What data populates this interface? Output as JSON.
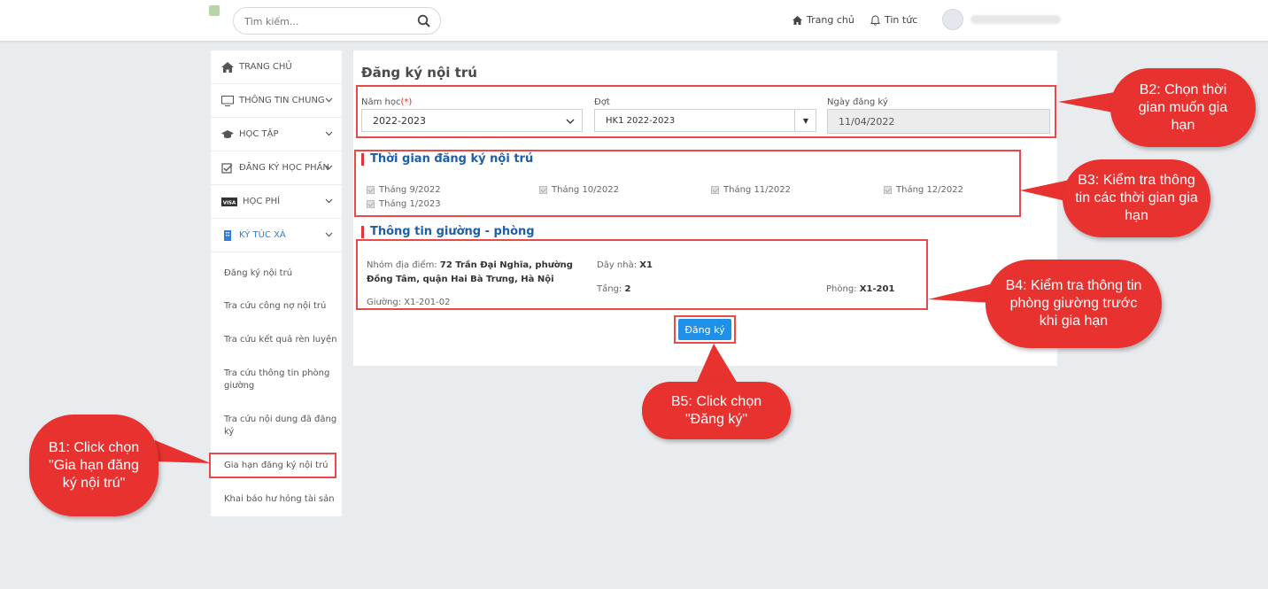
{
  "topbar": {
    "search_placeholder": "Tìm kiếm...",
    "home_label": "Trang chủ",
    "news_label": "Tin tức"
  },
  "sidebar": {
    "menu": [
      {
        "label": "TRANG CHỦ",
        "icon": "home-icon"
      },
      {
        "label": "THÔNG TIN CHUNG",
        "icon": "monitor-icon"
      },
      {
        "label": "HỌC TẬP",
        "icon": "graduation-cap-icon"
      },
      {
        "label": "ĐĂNG KÝ HỌC PHẦN",
        "icon": "checkbox-icon"
      },
      {
        "label": "HỌC PHÍ",
        "icon": "visa-card-icon"
      },
      {
        "label": "KÝ TÚC XÁ",
        "icon": "building-icon"
      }
    ],
    "sub_items": [
      "Đăng ký nội trú",
      "Tra cứu công nợ nội trú",
      "Tra cứu kết quả rèn luyện",
      "Tra cứu thông tin phòng giường",
      "Tra cứu nội dung đã đăng ký",
      "Gia hạn đăng ký nội trú",
      "Khai báo hư hỏng tài sản"
    ]
  },
  "form": {
    "title": "Đăng ký nội trú",
    "year_label": "Năm học",
    "year_required": "(*)",
    "year_value": "2022-2023",
    "term_label": "Đợt",
    "term_value": "HK1 2022-2023",
    "date_label": "Ngày đăng ký",
    "date_value": "11/04/2022"
  },
  "period_section": {
    "title": "Thời gian đăng ký nội trú",
    "months": [
      "Tháng 9/2022",
      "Tháng 10/2022",
      "Tháng 11/2022",
      "Tháng 12/2022",
      "Tháng 1/2023"
    ]
  },
  "room_section": {
    "title": "Thông tin giường - phòng",
    "location_label": "Nhóm địa điểm:",
    "location_value": "72 Trần Đại Nghĩa, phường Đồng Tâm, quận Hai Bà Trưng, Hà Nội",
    "building_label": "Dãy nhà:",
    "building_value": "X1",
    "floor_label": "Tầng:",
    "floor_value": "2",
    "room_label": "Phòng:",
    "room_value": "X1-201",
    "bed_label": "Giường:",
    "bed_value": "X1-201-02"
  },
  "register_button": "Đăng ký",
  "callouts": {
    "b1": "B1: Click chọn \"Gia hạn đăng ký nội trú\"",
    "b2": "B2: Chọn thời gian muốn gia hạn",
    "b3": "B3: Kiểm tra thông tin các thời gian gia hạn",
    "b4": "B4: Kiểm tra thông tin phòng giường trước khi gia hạn",
    "b5": "B5: Click chọn \"Đăng ký\""
  },
  "colors": {
    "accent_blue": "#1e90e8",
    "callout_red": "#e8322f",
    "section_title_blue": "#1f5fa6"
  }
}
